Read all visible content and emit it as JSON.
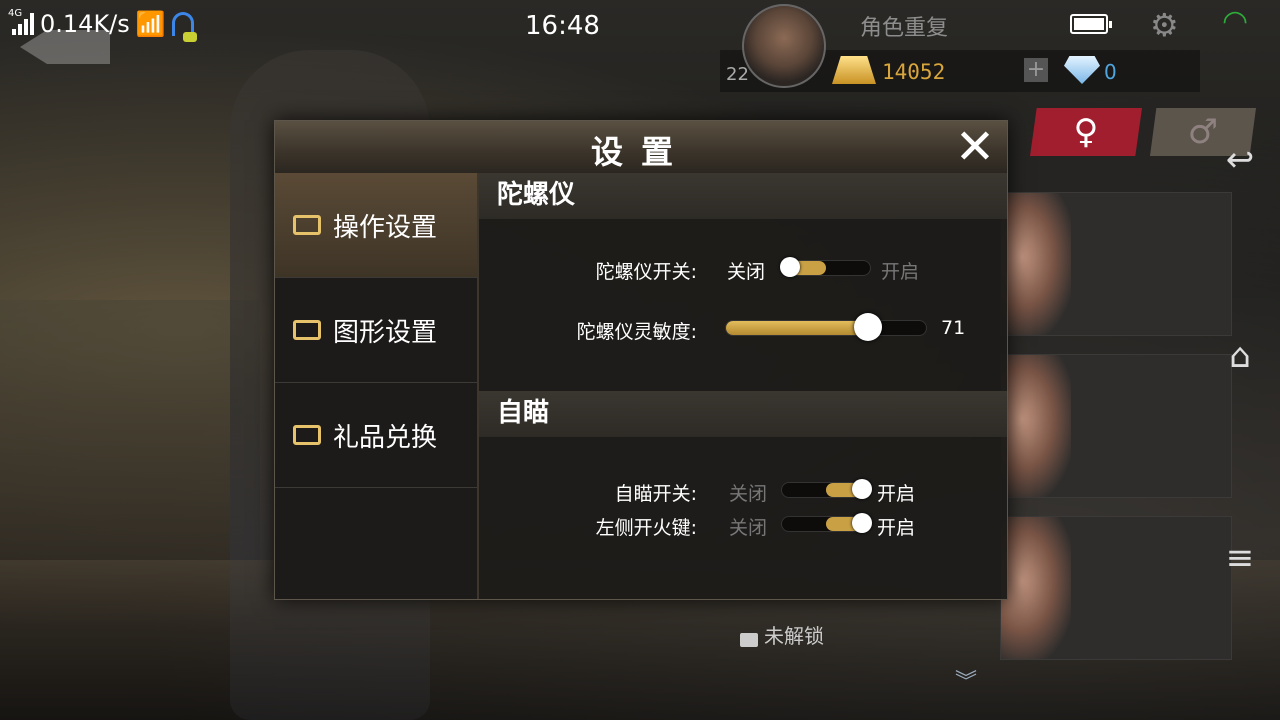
{
  "status_bar": {
    "network": "4G",
    "speed": "0.14K/s",
    "time": "16:48"
  },
  "hud": {
    "role_title": "角色重复",
    "level": "22",
    "gold": "14052",
    "plus": "+",
    "gems": "0"
  },
  "gender_tabs": {
    "female": "♀",
    "male": "♂"
  },
  "cards": {
    "locked_label": "未解锁"
  },
  "system_nav": {
    "back": "↩",
    "home": "⌂",
    "menu": "≡"
  },
  "dialog": {
    "title": "设置",
    "close": "✕",
    "sidebar": [
      {
        "label": "操作设置",
        "active": true
      },
      {
        "label": "图形设置",
        "active": false
      },
      {
        "label": "礼品兑换",
        "active": false
      }
    ],
    "gyro": {
      "header": "陀螺仪",
      "switch_label": "陀螺仪开关:",
      "off": "关闭",
      "on": "开启",
      "switch_state": "off",
      "sensitivity_label": "陀螺仪灵敏度:",
      "sensitivity": 71,
      "sensitivity_max": 100
    },
    "aim": {
      "header": "自瞄",
      "aim_switch_label": "自瞄开关:",
      "left_fire_label": "左侧开火键:",
      "off": "关闭",
      "on": "开启",
      "aim_state": "on",
      "left_fire_state": "on"
    }
  },
  "colors": {
    "accent_gold": "#c9a044",
    "female_tab": "#a11e2e",
    "gold_text": "#d9a63c",
    "gem_text": "#4fa6e0"
  }
}
